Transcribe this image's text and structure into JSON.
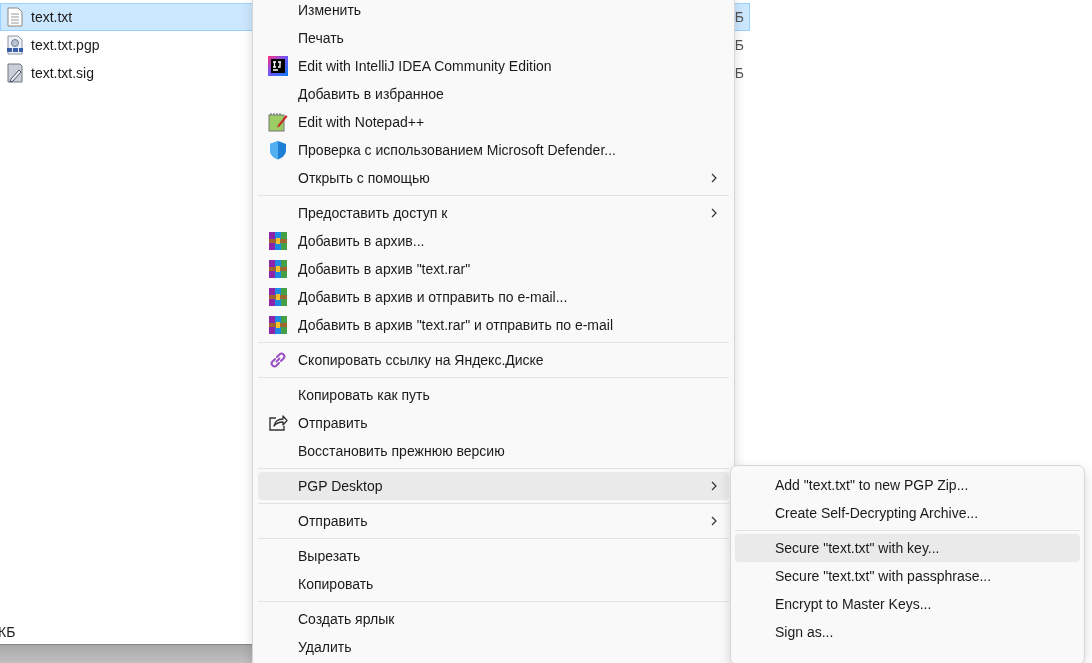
{
  "files": [
    {
      "name": "text.txt",
      "kind": "text",
      "size": "Б",
      "selected": true
    },
    {
      "name": "text.txt.pgp",
      "kind": "pgp",
      "size": "Б",
      "selected": false
    },
    {
      "name": "text.txt.sig",
      "kind": "sig",
      "size": "Б",
      "selected": false
    }
  ],
  "status_bar": {
    "text": "КБ"
  },
  "context_menu": {
    "items": [
      {
        "kind": "item",
        "label": "Изменить",
        "selected": false
      },
      {
        "kind": "item",
        "label": "Печать",
        "selected": false
      },
      {
        "kind": "intellij",
        "label": "Edit with IntelliJ IDEA Community Edition",
        "selected": false
      },
      {
        "kind": "item",
        "label": "Добавить в избранное",
        "selected": false
      },
      {
        "kind": "notepad",
        "label": "Edit with Notepad++",
        "selected": false
      },
      {
        "kind": "shield",
        "label": "Проверка с использованием Microsoft Defender...",
        "selected": false
      },
      {
        "kind": "item",
        "label": "Открыть с помощью",
        "has_submenu": true,
        "selected": false
      },
      {
        "kind": "separator"
      },
      {
        "kind": "item",
        "label": "Предоставить доступ к",
        "has_submenu": true,
        "selected": false
      },
      {
        "kind": "archive",
        "label": "Добавить в архив...",
        "selected": false
      },
      {
        "kind": "archive",
        "label": "Добавить в архив \"text.rar\"",
        "selected": false
      },
      {
        "kind": "archive",
        "label": "Добавить в архив и отправить по e-mail...",
        "selected": false
      },
      {
        "kind": "archive",
        "label": "Добавить в архив \"text.rar\" и отправить по e-mail",
        "selected": false
      },
      {
        "kind": "separator"
      },
      {
        "kind": "link",
        "label": "Скопировать ссылку на Яндекс.Диске",
        "selected": false
      },
      {
        "kind": "separator"
      },
      {
        "kind": "item",
        "label": "Копировать как путь",
        "selected": false
      },
      {
        "kind": "share",
        "label": "Отправить",
        "selected": false
      },
      {
        "kind": "item",
        "label": "Восстановить прежнюю версию",
        "selected": false
      },
      {
        "kind": "separator"
      },
      {
        "kind": "item",
        "label": "PGP Desktop",
        "has_submenu": true,
        "selected": true
      },
      {
        "kind": "separator"
      },
      {
        "kind": "item",
        "label": "Отправить",
        "has_submenu": true,
        "selected": false
      },
      {
        "kind": "separator"
      },
      {
        "kind": "item",
        "label": "Вырезать",
        "selected": false
      },
      {
        "kind": "item",
        "label": "Копировать",
        "selected": false
      },
      {
        "kind": "separator"
      },
      {
        "kind": "item",
        "label": "Создать ярлык",
        "selected": false
      },
      {
        "kind": "item",
        "label": "Удалить",
        "selected": false
      }
    ]
  },
  "submenu": {
    "items": [
      {
        "kind": "item",
        "label": "Add \"text.txt\" to new PGP Zip...",
        "selected": false
      },
      {
        "kind": "item",
        "label": "Create Self-Decrypting Archive...",
        "selected": false
      },
      {
        "kind": "separator"
      },
      {
        "kind": "item",
        "label": "Secure \"text.txt\" with key...",
        "selected": true
      },
      {
        "kind": "item",
        "label": "Secure \"text.txt\" with passphrase...",
        "selected": false
      },
      {
        "kind": "item",
        "label": "Encrypt to Master Keys...",
        "selected": false
      },
      {
        "kind": "item",
        "label": "Sign as...",
        "selected": false
      }
    ]
  }
}
